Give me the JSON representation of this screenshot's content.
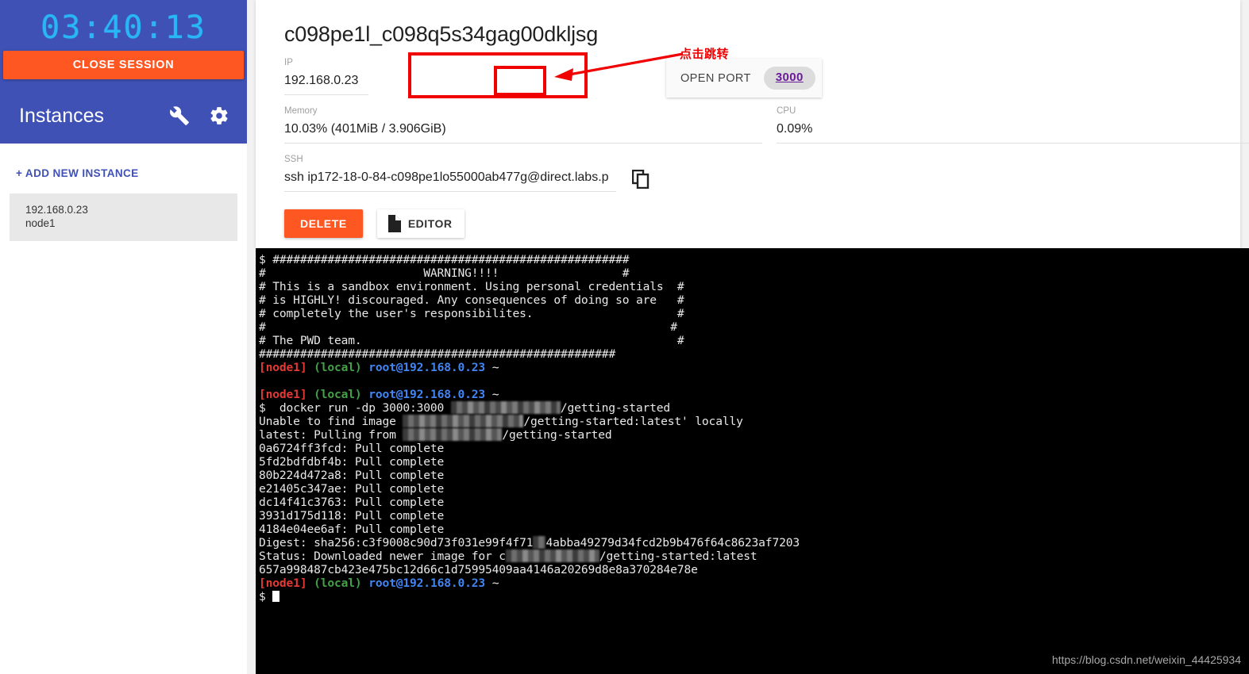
{
  "sidebar": {
    "timer": "03:40:13",
    "close_session_label": "CLOSE SESSION",
    "instances_title": "Instances",
    "wrench_icon": "wrench-icon",
    "gear_icon": "gear-icon",
    "add_new_instance_label": "+ ADD NEW INSTANCE",
    "instances": [
      {
        "ip": "192.168.0.23",
        "name": "node1"
      }
    ],
    "header_color": "#3f51b5",
    "accent_color": "#ff5722",
    "timer_color": "#29b6f6"
  },
  "instance": {
    "title": "c098pe1l_c098q5s34gag00dkljsg",
    "ip_label": "IP",
    "ip_value": "192.168.0.23",
    "memory_label": "Memory",
    "memory_value": "10.03% (401MiB / 3.906GiB)",
    "cpu_label": "CPU",
    "cpu_value": "0.09%",
    "ssh_label": "SSH",
    "ssh_value": "ssh ip172-18-0-84-c098pe1lo55000ab477g@direct.labs.p",
    "copy_icon": "copy-icon"
  },
  "ports": {
    "open_port_label": "OPEN PORT",
    "port_chip": "3000",
    "chip_link_color": "#6a1b9a"
  },
  "actions": {
    "delete_label": "DELETE",
    "editor_label": "EDITOR",
    "editor_icon": "file-icon"
  },
  "annotation": {
    "text": "点击跳转",
    "color": "#f00000"
  },
  "terminal": {
    "prompt": {
      "host": "[node1]",
      "scope": "(local)",
      "user": "root@192.168.0.23",
      "path": "~"
    },
    "banner": {
      "border": "####################################################",
      "l1_left": "#",
      "l1_center": "WARNING!!!!",
      "l1_right": "#",
      "l2_left": "# This is a sandbox environment. Using personal credentials",
      "l2_right": "#",
      "l3_left": "# is HIGHLY! discouraged. Any consequences of doing so are",
      "l3_right": "#",
      "l4_left": "# completely the user's responsibilites.",
      "l4_right": "#",
      "l5_left": "#",
      "l5_right": "#",
      "l6_left": "# The PWD team.",
      "l6_right": "#"
    },
    "dollar": "$",
    "command": "docker run -dp 3000:3000 ",
    "command_suffix": "/getting-started",
    "unable_prefix": "Unable to find image ",
    "unable_suffix": "/getting-started:latest' locally",
    "pulling_prefix": "latest: Pulling from ",
    "pulling_suffix": "/getting-started",
    "layers": [
      "0a6724ff3fcd: Pull complete",
      "5fd2bdfdbf4b: Pull complete",
      "80b224d472a8: Pull complete",
      "e21405c347ae: Pull complete",
      "dc14f41c3763: Pull complete",
      "3931d175d118: Pull complete",
      "4184e04ee6af: Pull complete"
    ],
    "digest_prefix": "Digest: sha256:c3f9008c90d73f031e99f4f71",
    "digest_suffix": "4abba49279d34fcd2b9b476f64c8623af7203",
    "status_prefix": "Status: Downloaded newer image for c",
    "status_suffix": "/getting-started:latest",
    "container_id": "657a998487cb423e475bc12d66c1d75995409aa4146a20269d8e8a370284e78e"
  },
  "watermark": "https://blog.csdn.net/weixin_44425934"
}
